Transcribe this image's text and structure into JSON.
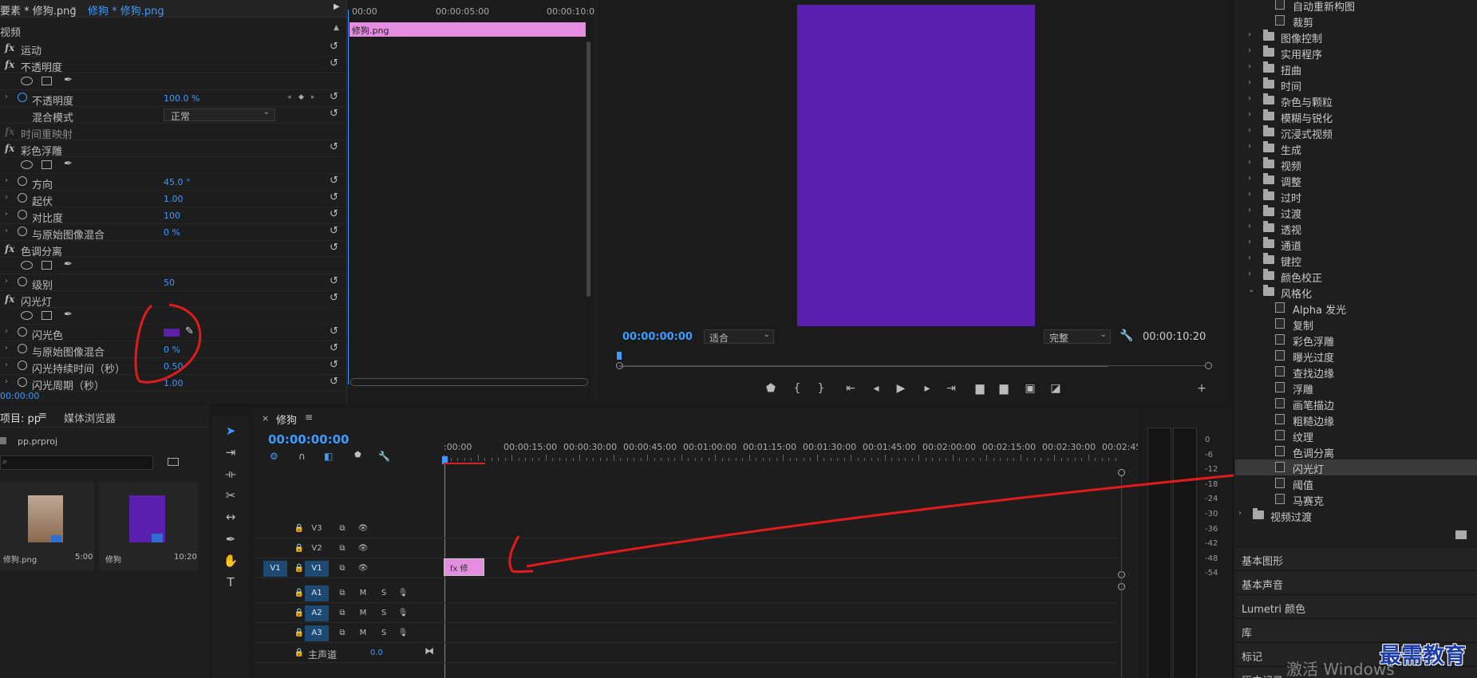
{
  "effect_controls": {
    "tab_source": "要素 * 修狗.png",
    "tab_active": "修狗 * 修狗.png",
    "section_video": "视频",
    "rows": [
      {
        "kind": "fx",
        "label": "运动"
      },
      {
        "kind": "fx",
        "label": "不透明度"
      },
      {
        "kind": "mask"
      },
      {
        "kind": "param",
        "label": "不透明度",
        "value": "100.0 %",
        "keyframes": true
      },
      {
        "kind": "select",
        "label": "混合模式",
        "value": "正常"
      },
      {
        "kind": "fxdim",
        "label": "时间重映射"
      },
      {
        "kind": "fx",
        "label": "彩色浮雕"
      },
      {
        "kind": "mask"
      },
      {
        "kind": "param",
        "label": "方向",
        "value": "45.0 °"
      },
      {
        "kind": "param",
        "label": "起伏",
        "value": "1.00"
      },
      {
        "kind": "param",
        "label": "对比度",
        "value": "100"
      },
      {
        "kind": "param",
        "label": "与原始图像混合",
        "value": "0 %"
      },
      {
        "kind": "fx",
        "label": "色调分离"
      },
      {
        "kind": "mask"
      },
      {
        "kind": "param",
        "label": "级别",
        "value": "50"
      },
      {
        "kind": "fx",
        "label": "闪光灯"
      },
      {
        "kind": "mask"
      },
      {
        "kind": "color",
        "label": "闪光色"
      },
      {
        "kind": "param",
        "label": "与原始图像混合",
        "value": "0 %"
      },
      {
        "kind": "param",
        "label": "闪光持续时间（秒）",
        "value": "0.50"
      },
      {
        "kind": "param",
        "label": "闪光周期（秒）",
        "value": "1.00"
      }
    ],
    "timecode": "00:00:00",
    "ruler": [
      "00:00",
      "00:00:05:00",
      "00:00:10:0"
    ],
    "clip_label": "修狗.png"
  },
  "program": {
    "timecode": "00:00:00:00",
    "fit": "适合",
    "quality": "完整",
    "duration": "00:00:10:20"
  },
  "effects_tree": [
    {
      "type": "file",
      "label": "自动重新构图"
    },
    {
      "type": "file",
      "label": "裁剪"
    },
    {
      "type": "folder",
      "label": "图像控制"
    },
    {
      "type": "folder",
      "label": "实用程序"
    },
    {
      "type": "folder",
      "label": "扭曲"
    },
    {
      "type": "folder",
      "label": "时间"
    },
    {
      "type": "folder",
      "label": "杂色与颗粒"
    },
    {
      "type": "folder",
      "label": "模糊与锐化"
    },
    {
      "type": "folder",
      "label": "沉浸式视频"
    },
    {
      "type": "folder",
      "label": "生成"
    },
    {
      "type": "folder",
      "label": "视频"
    },
    {
      "type": "folder",
      "label": "调整"
    },
    {
      "type": "folder",
      "label": "过时"
    },
    {
      "type": "folder",
      "label": "过渡"
    },
    {
      "type": "folder",
      "label": "透视"
    },
    {
      "type": "folder",
      "label": "通道"
    },
    {
      "type": "folder",
      "label": "键控"
    },
    {
      "type": "folder",
      "label": "颜色校正"
    },
    {
      "type": "folder-open",
      "label": "风格化"
    },
    {
      "type": "file",
      "label": "Alpha 发光"
    },
    {
      "type": "file",
      "label": "复制"
    },
    {
      "type": "file",
      "label": "彩色浮雕"
    },
    {
      "type": "file",
      "label": "曝光过度"
    },
    {
      "type": "file",
      "label": "查找边缘"
    },
    {
      "type": "file",
      "label": "浮雕"
    },
    {
      "type": "file",
      "label": "画笔描边"
    },
    {
      "type": "file",
      "label": "粗糙边缘"
    },
    {
      "type": "file",
      "label": "纹理"
    },
    {
      "type": "file",
      "label": "色调分离"
    },
    {
      "type": "file",
      "label": "闪光灯",
      "selected": true
    },
    {
      "type": "file",
      "label": "阈值"
    },
    {
      "type": "file",
      "label": "马赛克"
    },
    {
      "type": "root-folder",
      "label": "视频过渡"
    }
  ],
  "side_panels": [
    "基本图形",
    "基本声音",
    "Lumetri 颜色",
    "库",
    "标记",
    "历史记录"
  ],
  "project": {
    "tab_project": "项目: pp",
    "tab_media": "媒体浏览器",
    "file": "pp.prproj",
    "items": [
      {
        "name": "修狗.png",
        "duration": "5:00"
      },
      {
        "name": "修狗",
        "duration": "10:20"
      }
    ]
  },
  "timeline": {
    "sequence": "修狗",
    "timecode": "00:00:00:00",
    "ruler": [
      ":00:00",
      "00:00:15:00",
      "00:00:30:00",
      "00:00:45:00",
      "00:01:00:00",
      "00:01:15:00",
      "00:01:30:00",
      "00:01:45:00",
      "00:02:00:00",
      "00:02:15:00",
      "00:02:30:00",
      "00:02:45:"
    ],
    "video_tracks": [
      "V3",
      "V2",
      "V1"
    ],
    "audio_tracks": [
      "A1",
      "A2",
      "A3"
    ],
    "source_patch": "V1",
    "master": "主声道",
    "master_value": "0.0",
    "clip_label": "fx  修",
    "mute": "M",
    "solo": "S"
  },
  "meter_scale": [
    "0",
    "-6",
    "-12",
    "-18",
    "-24",
    "-30",
    "-36",
    "-42",
    "-48",
    "-54"
  ],
  "watermark": "激活 Windows",
  "brand": "最需教育",
  "colors": {
    "flash_color": "#5b1fa8",
    "program_frame": "#5b1fb0",
    "accent": "#3d9bff",
    "clip": "#e58de0",
    "annotation": "#e01b1b"
  }
}
